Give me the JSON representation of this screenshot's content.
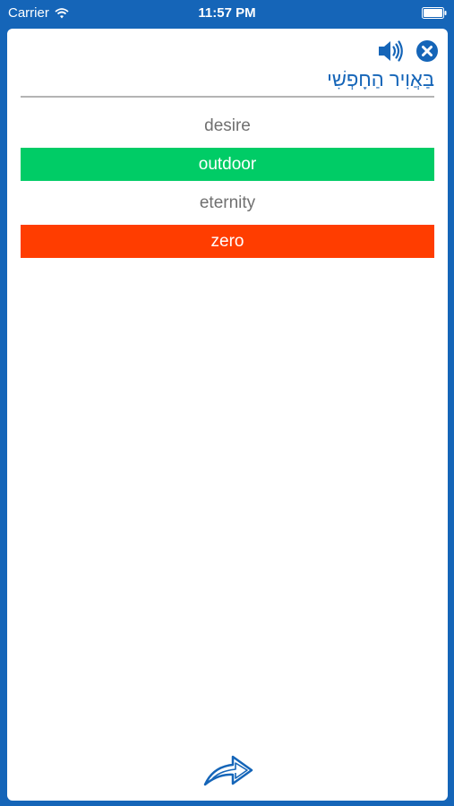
{
  "status_bar": {
    "carrier": "Carrier",
    "time": "11:57 PM",
    "wifi_icon": "wifi-icon",
    "battery_icon": "battery-icon"
  },
  "colors": {
    "frame_blue": "#1565b8",
    "correct_green": "#00cc66",
    "wrong_red": "#ff3d00"
  },
  "question": {
    "word": "בַּאֲוִיר הַחָפְשִׁי",
    "speaker_icon": "speaker-icon",
    "close_icon": "close-icon"
  },
  "answers": [
    {
      "label": "desire",
      "state": "neutral"
    },
    {
      "label": "outdoor",
      "state": "correct"
    },
    {
      "label": "eternity",
      "state": "neutral"
    },
    {
      "label": "zero",
      "state": "wrong"
    }
  ],
  "footer": {
    "next_icon": "share-arrow-icon"
  }
}
